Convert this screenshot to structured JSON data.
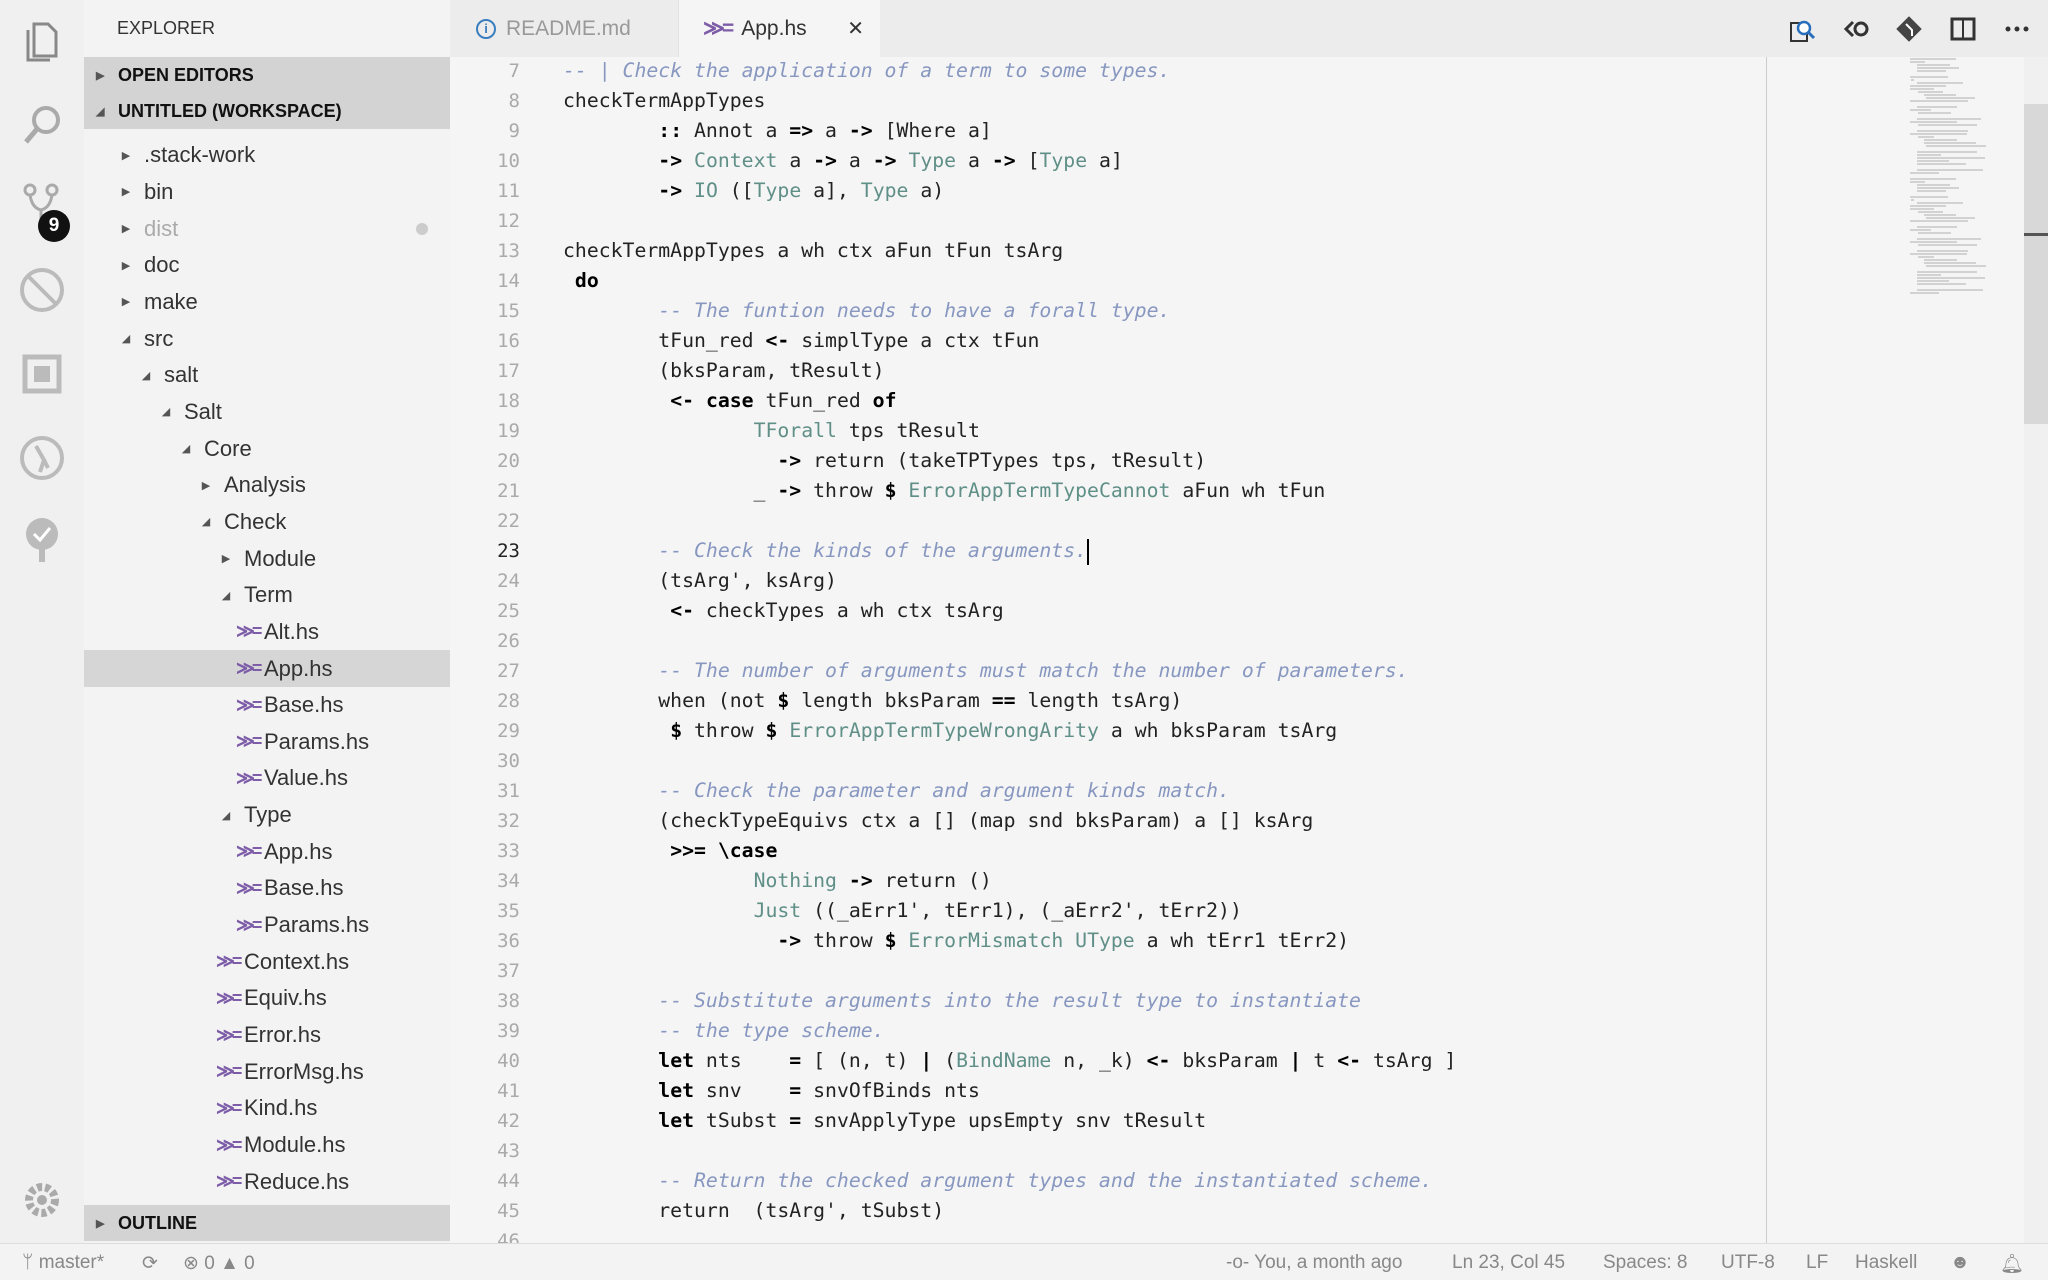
{
  "activity": {
    "icons": [
      "files-icon",
      "search-icon",
      "source-control-icon",
      "debug-icon",
      "extensions-icon",
      "git-graph-icon",
      "tree-icon",
      "settings-icon"
    ],
    "scm_badge": "9"
  },
  "sidebar": {
    "title": "EXPLORER",
    "open_editors": "OPEN EDITORS",
    "workspace": "UNTITLED (WORKSPACE)",
    "outline": "OUTLINE",
    "tree": [
      {
        "label": ".stack-work",
        "depth": 0,
        "type": "folder",
        "open": false
      },
      {
        "label": "bin",
        "depth": 0,
        "type": "folder",
        "open": false
      },
      {
        "label": "dist",
        "depth": 0,
        "type": "folder",
        "open": false,
        "dim": true
      },
      {
        "label": "doc",
        "depth": 0,
        "type": "folder",
        "open": false
      },
      {
        "label": "make",
        "depth": 0,
        "type": "folder",
        "open": false
      },
      {
        "label": "src",
        "depth": 0,
        "type": "folder",
        "open": true
      },
      {
        "label": "salt",
        "depth": 1,
        "type": "folder",
        "open": true
      },
      {
        "label": "Salt",
        "depth": 2,
        "type": "folder",
        "open": true
      },
      {
        "label": "Core",
        "depth": 3,
        "type": "folder",
        "open": true
      },
      {
        "label": "Analysis",
        "depth": 4,
        "type": "folder",
        "open": false
      },
      {
        "label": "Check",
        "depth": 4,
        "type": "folder",
        "open": true
      },
      {
        "label": "Module",
        "depth": 5,
        "type": "folder",
        "open": false
      },
      {
        "label": "Term",
        "depth": 5,
        "type": "folder",
        "open": true
      },
      {
        "label": "Alt.hs",
        "depth": 6,
        "type": "file"
      },
      {
        "label": "App.hs",
        "depth": 6,
        "type": "file",
        "selected": true
      },
      {
        "label": "Base.hs",
        "depth": 6,
        "type": "file"
      },
      {
        "label": "Params.hs",
        "depth": 6,
        "type": "file"
      },
      {
        "label": "Value.hs",
        "depth": 6,
        "type": "file"
      },
      {
        "label": "Type",
        "depth": 5,
        "type": "folder",
        "open": true
      },
      {
        "label": "App.hs",
        "depth": 6,
        "type": "file"
      },
      {
        "label": "Base.hs",
        "depth": 6,
        "type": "file"
      },
      {
        "label": "Params.hs",
        "depth": 6,
        "type": "file"
      },
      {
        "label": "Context.hs",
        "depth": 5,
        "type": "file"
      },
      {
        "label": "Equiv.hs",
        "depth": 5,
        "type": "file"
      },
      {
        "label": "Error.hs",
        "depth": 5,
        "type": "file"
      },
      {
        "label": "ErrorMsg.hs",
        "depth": 5,
        "type": "file"
      },
      {
        "label": "Kind.hs",
        "depth": 5,
        "type": "file"
      },
      {
        "label": "Module.hs",
        "depth": 5,
        "type": "file"
      },
      {
        "label": "Reduce.hs",
        "depth": 5,
        "type": "file"
      }
    ]
  },
  "tabs": [
    {
      "label": "README.md",
      "icon": "info-icon"
    },
    {
      "label": "App.hs",
      "icon": "haskell-icon",
      "active": true
    }
  ],
  "toolbar": [
    "open-preview-icon",
    "go-back-icon",
    "git-icon",
    "split-editor-icon",
    "more-icon"
  ],
  "colors": {
    "comment": "#8797c0",
    "type": "#5f8f87",
    "haskell_icon": "#7d5ca8"
  },
  "editor": {
    "cursor_line": 23,
    "lines": [
      {
        "n": 7,
        "s": [
          [
            "c",
            "-- | Check the application of a term to some types."
          ]
        ]
      },
      {
        "n": 8,
        "s": [
          [
            "p",
            "checkTermAppTypes"
          ]
        ]
      },
      {
        "n": 9,
        "s": [
          [
            "p",
            "        "
          ],
          [
            "k",
            "::"
          ],
          [
            "p",
            " Annot a "
          ],
          [
            "k",
            "=>"
          ],
          [
            "p",
            " a "
          ],
          [
            "k",
            "->"
          ],
          [
            "p",
            " [Where a]"
          ]
        ]
      },
      {
        "n": 10,
        "s": [
          [
            "p",
            "        "
          ],
          [
            "k",
            "->"
          ],
          [
            "p",
            " "
          ],
          [
            "t",
            "Context"
          ],
          [
            "p",
            " a "
          ],
          [
            "k",
            "->"
          ],
          [
            "p",
            " a "
          ],
          [
            "k",
            "->"
          ],
          [
            "p",
            " "
          ],
          [
            "t",
            "Type"
          ],
          [
            "p",
            " a "
          ],
          [
            "k",
            "->"
          ],
          [
            "p",
            " ["
          ],
          [
            "t",
            "Type"
          ],
          [
            "p",
            " a]"
          ]
        ]
      },
      {
        "n": 11,
        "s": [
          [
            "p",
            "        "
          ],
          [
            "k",
            "->"
          ],
          [
            "p",
            " "
          ],
          [
            "t",
            "IO"
          ],
          [
            "p",
            " (["
          ],
          [
            "t",
            "Type"
          ],
          [
            "p",
            " a], "
          ],
          [
            "t",
            "Type"
          ],
          [
            "p",
            " a)"
          ]
        ]
      },
      {
        "n": 12,
        "s": []
      },
      {
        "n": 13,
        "s": [
          [
            "p",
            "checkTermAppTypes a wh ctx aFun tFun tsArg"
          ]
        ]
      },
      {
        "n": 14,
        "s": [
          [
            "p",
            " "
          ],
          [
            "k",
            "do"
          ]
        ]
      },
      {
        "n": 15,
        "s": [
          [
            "p",
            "        "
          ],
          [
            "c",
            "-- The funtion needs to have a forall type."
          ]
        ]
      },
      {
        "n": 16,
        "s": [
          [
            "p",
            "        tFun_red "
          ],
          [
            "k",
            "<-"
          ],
          [
            "p",
            " simplType a ctx tFun"
          ]
        ]
      },
      {
        "n": 17,
        "s": [
          [
            "p",
            "        (bksParam, tResult)"
          ]
        ]
      },
      {
        "n": 18,
        "s": [
          [
            "p",
            "         "
          ],
          [
            "k",
            "<-"
          ],
          [
            "p",
            " "
          ],
          [
            "k",
            "case"
          ],
          [
            "p",
            " tFun_red "
          ],
          [
            "k",
            "of"
          ]
        ]
      },
      {
        "n": 19,
        "s": [
          [
            "p",
            "                "
          ],
          [
            "t",
            "TForall"
          ],
          [
            "p",
            " tps tResult"
          ]
        ]
      },
      {
        "n": 20,
        "s": [
          [
            "p",
            "                  "
          ],
          [
            "k",
            "->"
          ],
          [
            "p",
            " return (takeTPTypes tps, tResult)"
          ]
        ]
      },
      {
        "n": 21,
        "s": [
          [
            "p",
            "                _ "
          ],
          [
            "k",
            "->"
          ],
          [
            "p",
            " throw "
          ],
          [
            "k",
            "$"
          ],
          [
            "p",
            " "
          ],
          [
            "t",
            "ErrorAppTermTypeCannot"
          ],
          [
            "p",
            " aFun wh tFun"
          ]
        ]
      },
      {
        "n": 22,
        "s": []
      },
      {
        "n": 23,
        "s": [
          [
            "p",
            "        "
          ],
          [
            "c",
            "-- Check the kinds of the arguments."
          ]
        ]
      },
      {
        "n": 24,
        "s": [
          [
            "p",
            "        (tsArg', ksArg)"
          ]
        ]
      },
      {
        "n": 25,
        "s": [
          [
            "p",
            "         "
          ],
          [
            "k",
            "<-"
          ],
          [
            "p",
            " checkTypes a wh ctx tsArg"
          ]
        ]
      },
      {
        "n": 26,
        "s": []
      },
      {
        "n": 27,
        "s": [
          [
            "p",
            "        "
          ],
          [
            "c",
            "-- The number of arguments must match the number of parameters."
          ]
        ]
      },
      {
        "n": 28,
        "s": [
          [
            "p",
            "        when (not "
          ],
          [
            "k",
            "$"
          ],
          [
            "p",
            " length bksParam "
          ],
          [
            "k",
            "=="
          ],
          [
            "p",
            " length tsArg)"
          ]
        ]
      },
      {
        "n": 29,
        "s": [
          [
            "p",
            "         "
          ],
          [
            "k",
            "$"
          ],
          [
            "p",
            " throw "
          ],
          [
            "k",
            "$"
          ],
          [
            "p",
            " "
          ],
          [
            "t",
            "ErrorAppTermTypeWrongArity"
          ],
          [
            "p",
            " a wh bksParam tsArg"
          ]
        ]
      },
      {
        "n": 30,
        "s": []
      },
      {
        "n": 31,
        "s": [
          [
            "p",
            "        "
          ],
          [
            "c",
            "-- Check the parameter and argument kinds match."
          ]
        ]
      },
      {
        "n": 32,
        "s": [
          [
            "p",
            "        (checkTypeEquivs ctx a [] (map snd bksParam) a [] ksArg"
          ]
        ]
      },
      {
        "n": 33,
        "s": [
          [
            "p",
            "         "
          ],
          [
            "k",
            ">>= \\case"
          ]
        ]
      },
      {
        "n": 34,
        "s": [
          [
            "p",
            "                "
          ],
          [
            "t",
            "Nothing"
          ],
          [
            "p",
            " "
          ],
          [
            "k",
            "->"
          ],
          [
            "p",
            " return ()"
          ]
        ]
      },
      {
        "n": 35,
        "s": [
          [
            "p",
            "                "
          ],
          [
            "t",
            "Just"
          ],
          [
            "p",
            " ((_aErr1', tErr1), (_aErr2', tErr2))"
          ]
        ]
      },
      {
        "n": 36,
        "s": [
          [
            "p",
            "                  "
          ],
          [
            "k",
            "->"
          ],
          [
            "p",
            " throw "
          ],
          [
            "k",
            "$"
          ],
          [
            "p",
            " "
          ],
          [
            "t",
            "ErrorMismatch"
          ],
          [
            "p",
            " "
          ],
          [
            "t",
            "UType"
          ],
          [
            "p",
            " a wh tErr1 tErr2)"
          ]
        ]
      },
      {
        "n": 37,
        "s": []
      },
      {
        "n": 38,
        "s": [
          [
            "p",
            "        "
          ],
          [
            "c",
            "-- Substitute arguments into the result type to instantiate"
          ]
        ]
      },
      {
        "n": 39,
        "s": [
          [
            "p",
            "        "
          ],
          [
            "c",
            "-- the type scheme."
          ]
        ]
      },
      {
        "n": 40,
        "s": [
          [
            "p",
            "        "
          ],
          [
            "k",
            "let"
          ],
          [
            "p",
            " nts    "
          ],
          [
            "k",
            "="
          ],
          [
            "p",
            " [ (n, t) "
          ],
          [
            "k",
            "|"
          ],
          [
            "p",
            " ("
          ],
          [
            "t",
            "BindName"
          ],
          [
            "p",
            " n, _k) "
          ],
          [
            "k",
            "<-"
          ],
          [
            "p",
            " bksParam "
          ],
          [
            "k",
            "|"
          ],
          [
            "p",
            " t "
          ],
          [
            "k",
            "<-"
          ],
          [
            "p",
            " tsArg ]"
          ]
        ]
      },
      {
        "n": 41,
        "s": [
          [
            "p",
            "        "
          ],
          [
            "k",
            "let"
          ],
          [
            "p",
            " snv    "
          ],
          [
            "k",
            "="
          ],
          [
            "p",
            " snvOfBinds nts"
          ]
        ]
      },
      {
        "n": 42,
        "s": [
          [
            "p",
            "        "
          ],
          [
            "k",
            "let"
          ],
          [
            "p",
            " tSubst "
          ],
          [
            "k",
            "="
          ],
          [
            "p",
            " snvApplyType upsEmpty snv tResult"
          ]
        ]
      },
      {
        "n": 43,
        "s": []
      },
      {
        "n": 44,
        "s": [
          [
            "p",
            "        "
          ],
          [
            "c",
            "-- Return the checked argument types and the instantiated scheme."
          ]
        ]
      },
      {
        "n": 45,
        "s": [
          [
            "p",
            "        return  (tsArg', tSubst)"
          ]
        ]
      },
      {
        "n": 46,
        "s": []
      }
    ]
  },
  "status": {
    "branch": "master*",
    "errors": "0",
    "warnings": "0",
    "blame": "You, a month ago",
    "position": "Ln 23, Col 45",
    "spaces": "Spaces: 8",
    "encoding": "UTF-8",
    "eol": "LF",
    "language": "Haskell"
  }
}
